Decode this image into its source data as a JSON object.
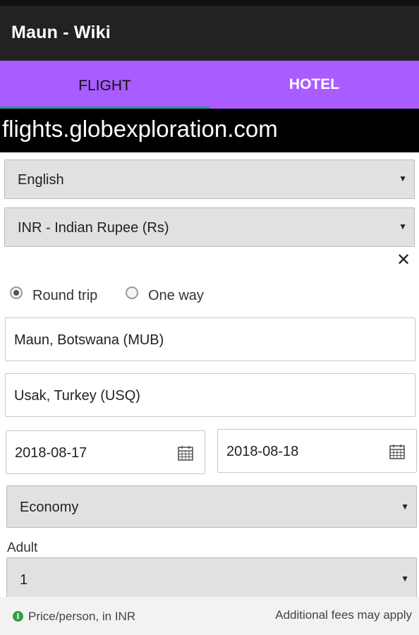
{
  "app": {
    "title": "Maun - Wiki"
  },
  "tabs": [
    {
      "label": "FLIGHT",
      "selected": true
    },
    {
      "label": "HOTEL",
      "selected": false
    }
  ],
  "url": "flights.globexploration.com",
  "language": {
    "value": "English"
  },
  "currency": {
    "value": "INR - Indian Rupee (Rs)"
  },
  "trip_type": {
    "options": [
      {
        "label": "Round trip",
        "checked": true
      },
      {
        "label": "One way",
        "checked": false
      }
    ]
  },
  "origin": {
    "value": "Maun, Botswana (MUB)"
  },
  "destination": {
    "value": "Usak, Turkey (USQ)"
  },
  "dates": {
    "depart": "2018-08-17",
    "return": "2018-08-18"
  },
  "cabin_class": {
    "value": "Economy"
  },
  "adult": {
    "label": "Adult",
    "value": "1"
  },
  "footer": {
    "price_note": "Price/person, in INR",
    "fees_note": "Additional fees may apply"
  },
  "colors": {
    "appbar": "#222222",
    "tabs_bg": "#a95cff",
    "tab_indicator": "#1f9c88",
    "info_icon": "#2f9e44"
  },
  "icons": [
    "close-icon",
    "calendar-icon",
    "info-icon",
    "dropdown-caret-icon"
  ]
}
